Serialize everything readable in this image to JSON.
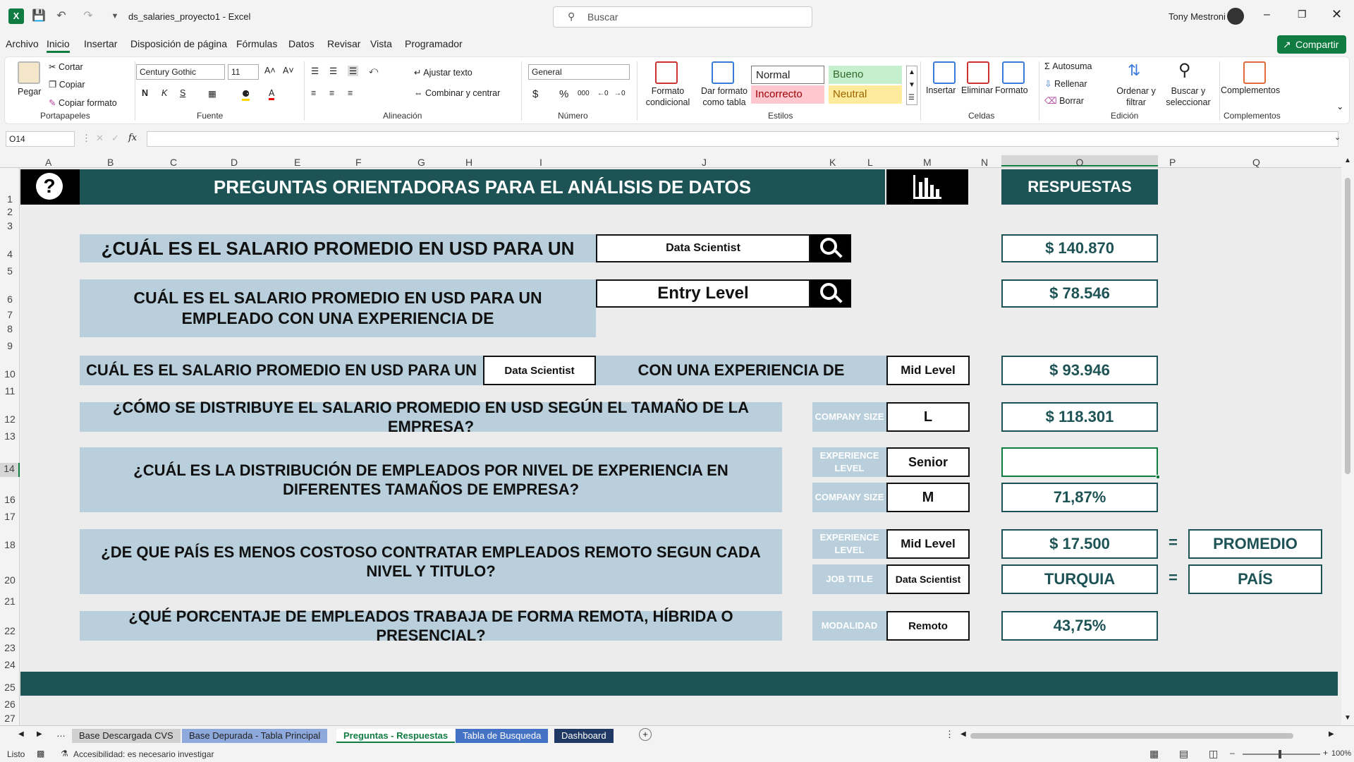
{
  "title": {
    "filename": "ds_salaries_proyecto1",
    "app": "Excel",
    "user": "Tony Mestroni"
  },
  "search": {
    "placeholder": "Buscar"
  },
  "menu": [
    "Archivo",
    "Inicio",
    "Insertar",
    "Disposición de página",
    "Fórmulas",
    "Datos",
    "Revisar",
    "Vista",
    "Programador"
  ],
  "share_label": "Compartir",
  "ribbon": {
    "clipboard": {
      "paste": "Pegar",
      "cut": "Cortar",
      "copy": "Copiar",
      "format_painter": "Copiar formato",
      "group": "Portapapeles"
    },
    "font": {
      "name": "Century Gothic",
      "size": "11",
      "group": "Fuente"
    },
    "alignment": {
      "wrap": "Ajustar texto",
      "merge": "Combinar y centrar",
      "group": "Alineación"
    },
    "number": {
      "format": "General",
      "group": "Número"
    },
    "styles": {
      "cond_format": "Formato condicional",
      "as_table": "Dar formato como tabla",
      "normal": "Normal",
      "good": "Bueno",
      "bad": "Incorrecto",
      "neutral": "Neutral",
      "group": "Estilos"
    },
    "cells": {
      "insert": "Insertar",
      "delete": "Eliminar",
      "format": "Formato",
      "group": "Celdas"
    },
    "editing": {
      "autosum": "Autosuma",
      "fill": "Rellenar",
      "clear": "Borrar",
      "sort": "Ordenar y filtrar",
      "find": "Buscar y seleccionar",
      "group": "Edición"
    },
    "addins": {
      "label": "Complementos",
      "group": "Complementos"
    }
  },
  "namebox": "O14",
  "columns": [
    "A",
    "B",
    "C",
    "D",
    "E",
    "F",
    "G",
    "H",
    "I",
    "J",
    "K",
    "L",
    "M",
    "N",
    "O",
    "P",
    "Q"
  ],
  "rows": [
    "1",
    "2",
    "3",
    "4",
    "5",
    "6",
    "7",
    "8",
    "9",
    "10",
    "11",
    "12",
    "13",
    "14",
    "16",
    "17",
    "18",
    "20",
    "21",
    "22",
    "23",
    "24",
    "25",
    "26",
    "27"
  ],
  "sheet": {
    "header_title": "PREGUNTAS ORIENTADORAS PARA EL ANÁLISIS DE DATOS",
    "answers_header": "RESPUESTAS",
    "q1": "¿CUÁL ES EL SALARIO PROMEDIO EN USD PARA UN",
    "q1_input": "Data Scientist",
    "q1_answer": "$ 140.870",
    "q2": "CUÁL ES EL SALARIO PROMEDIO EN USD PARA UN EMPLEADO CON UNA EXPERIENCIA DE",
    "q2_input": "Entry Level",
    "q2_answer": "$ 78.546",
    "q3a": "CUÁL ES EL SALARIO PROMEDIO EN USD PARA UN",
    "q3_input_title": "Data Scientist",
    "q3b": "CON UNA EXPERIENCIA DE",
    "q3_input_level": "Mid Level",
    "q3_answer": "$ 93.946",
    "q4": "¿CÓMO SE DISTRIBUYE EL SALARIO PROMEDIO EN USD SEGÚN EL TAMAÑO DE LA EMPRESA?",
    "q4_label": "COMPANY SIZE",
    "q4_input": "L",
    "q4_answer": "$ 118.301",
    "q5": "¿CUÁL ES LA DISTRIBUCIÓN DE EMPLEADOS POR NIVEL DE EXPERIENCIA EN DIFERENTES TAMAÑOS DE EMPRESA?",
    "q5_label1": "EXPERIENCE LEVEL",
    "q5_input1": "Senior",
    "q5_answer1": "",
    "q5_label2": "COMPANY SIZE",
    "q5_input2": "M",
    "q5_answer2": "71,87%",
    "q6": "¿DE QUE PAÍS ES MENOS COSTOSO CONTRATAR EMPLEADOS REMOTO SEGUN CADA NIVEL Y TITULO?",
    "q6_label1": "EXPERIENCE LEVEL",
    "q6_input1": "Mid Level",
    "q6_answer1": "$ 17.500",
    "q6_eq1": "=",
    "q6_tag1": "PROMEDIO",
    "q6_label2": "JOB TITLE",
    "q6_input2": "Data Scientist",
    "q6_answer2": "TURQUIA",
    "q6_eq2": "=",
    "q6_tag2": "PAÍS",
    "q7": "¿QUÉ  PORCENTAJE DE EMPLEADOS TRABAJA DE FORMA REMOTA, HÍBRIDA O PRESENCIAL?",
    "q7_label": "MODALIDAD",
    "q7_input": "Remoto",
    "q7_answer": "43,75%"
  },
  "tabs": [
    {
      "label": "Base Descargada CVS"
    },
    {
      "label": "Base Depurada - Tabla Principal"
    },
    {
      "label": "Preguntas - Respuestas"
    },
    {
      "label": "Tabla de Busqueda"
    },
    {
      "label": "Dashboard"
    }
  ],
  "status": {
    "ready": "Listo",
    "accessibility": "Accesibilidad: es necesario investigar",
    "zoom": "100%"
  },
  "colors": {
    "dark_teal": "#1e5356",
    "light_blue": "#b9cfdc",
    "excel_green": "#107c41"
  }
}
